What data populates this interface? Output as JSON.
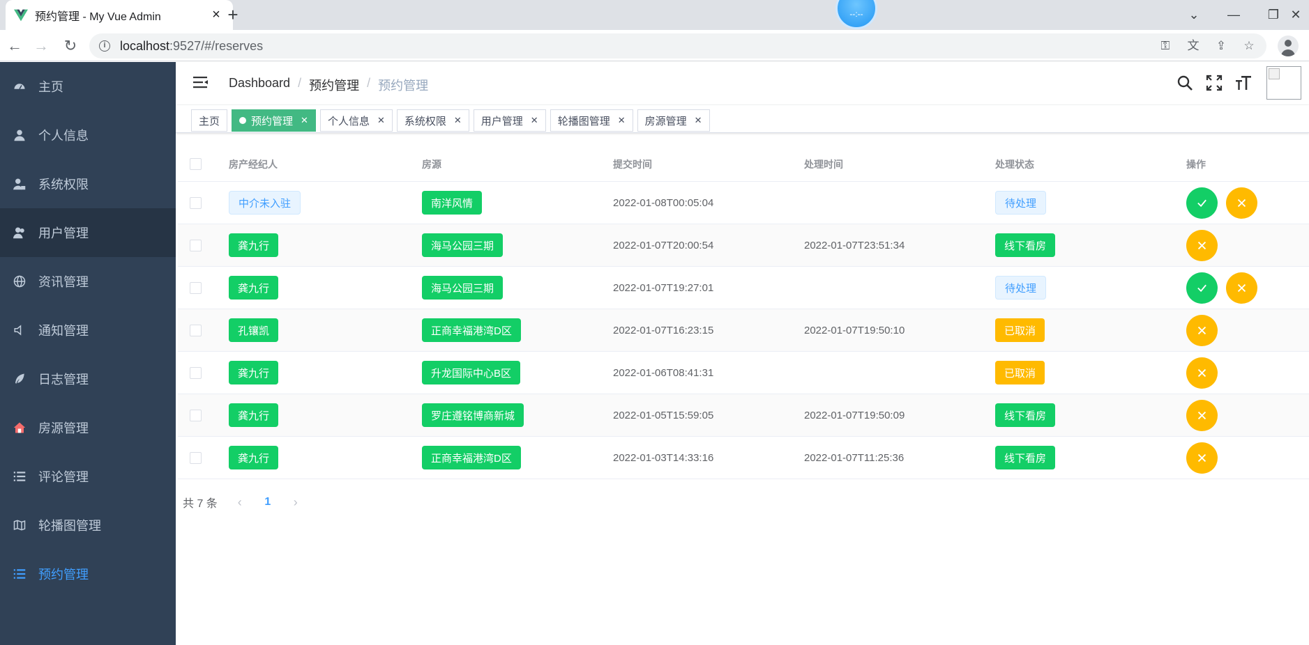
{
  "browser": {
    "tab_title": "预约管理 - My Vue Admin",
    "url_host": "localhost",
    "url_rest": ":9527/#/reserves",
    "recorder_text": "--:--",
    "favicon_color": "#42b983"
  },
  "sidebar": {
    "items": [
      {
        "label": "主页",
        "icon": "dashboard-icon"
      },
      {
        "label": "个人信息",
        "icon": "user-icon"
      },
      {
        "label": "系统权限",
        "icon": "user-lock-icon"
      },
      {
        "label": "用户管理",
        "icon": "users-icon"
      },
      {
        "label": "资讯管理",
        "icon": "globe-icon"
      },
      {
        "label": "通知管理",
        "icon": "speaker-icon"
      },
      {
        "label": "日志管理",
        "icon": "feather-icon"
      },
      {
        "label": "房源管理",
        "icon": "house-icon"
      },
      {
        "label": "评论管理",
        "icon": "list-icon"
      },
      {
        "label": "轮播图管理",
        "icon": "map-icon"
      },
      {
        "label": "预约管理",
        "icon": "list-icon"
      }
    ],
    "active_index": 10,
    "hover_index": 3
  },
  "breadcrumb": [
    "Dashboard",
    "预约管理",
    "预约管理"
  ],
  "tags": [
    {
      "label": "主页",
      "active": false,
      "closable": false
    },
    {
      "label": "预约管理",
      "active": true,
      "closable": true
    },
    {
      "label": "个人信息",
      "active": false,
      "closable": true
    },
    {
      "label": "系统权限",
      "active": false,
      "closable": true
    },
    {
      "label": "用户管理",
      "active": false,
      "closable": true
    },
    {
      "label": "轮播图管理",
      "active": false,
      "closable": true
    },
    {
      "label": "房源管理",
      "active": false,
      "closable": true
    }
  ],
  "table": {
    "headers": {
      "agent": "房产经纪人",
      "house": "房源",
      "submit_time": "提交时间",
      "handle_time": "处理时间",
      "status": "处理状态",
      "ops": "操作"
    },
    "rows": [
      {
        "agent": "中介未入驻",
        "agent_style": "info",
        "house": "南洋风情",
        "submit_time": "2022-01-08T00:05:04",
        "handle_time": "",
        "status": "待处理",
        "status_style": "info",
        "ops": [
          "confirm",
          "cancel"
        ]
      },
      {
        "agent": "龚九行",
        "agent_style": "green",
        "house": "海马公园三期",
        "submit_time": "2022-01-07T20:00:54",
        "handle_time": "2022-01-07T23:51:34",
        "status": "线下看房",
        "status_style": "green",
        "ops": [
          "cancel"
        ]
      },
      {
        "agent": "龚九行",
        "agent_style": "green",
        "house": "海马公园三期",
        "submit_time": "2022-01-07T19:27:01",
        "handle_time": "",
        "status": "待处理",
        "status_style": "info",
        "ops": [
          "confirm",
          "cancel"
        ]
      },
      {
        "agent": "孔镶凯",
        "agent_style": "green",
        "house": "正商幸福港湾D区",
        "submit_time": "2022-01-07T16:23:15",
        "handle_time": "2022-01-07T19:50:10",
        "status": "已取消",
        "status_style": "warn",
        "ops": [
          "cancel"
        ]
      },
      {
        "agent": "龚九行",
        "agent_style": "green",
        "house": "升龙国际中心B区",
        "submit_time": "2022-01-06T08:41:31",
        "handle_time": "",
        "status": "已取消",
        "status_style": "warn",
        "ops": [
          "cancel"
        ]
      },
      {
        "agent": "龚九行",
        "agent_style": "green",
        "house": "罗庄遵铭博商新城",
        "submit_time": "2022-01-05T15:59:05",
        "handle_time": "2022-01-07T19:50:09",
        "status": "线下看房",
        "status_style": "green",
        "ops": [
          "cancel"
        ]
      },
      {
        "agent": "龚九行",
        "agent_style": "green",
        "house": "正商幸福港湾D区",
        "submit_time": "2022-01-03T14:33:16",
        "handle_time": "2022-01-07T11:25:36",
        "status": "线下看房",
        "status_style": "green",
        "ops": [
          "cancel"
        ]
      }
    ]
  },
  "pagination": {
    "total_text": "共 7 条",
    "current_page": "1",
    "prev_symbol": "‹",
    "next_symbol": "›"
  },
  "colors": {
    "sidebar_bg": "#304156",
    "sidebar_text": "#bfcbd9",
    "active_blue": "#409eff",
    "tag_active": "#42b983",
    "success": "#13ce66",
    "warning": "#ffba00"
  }
}
